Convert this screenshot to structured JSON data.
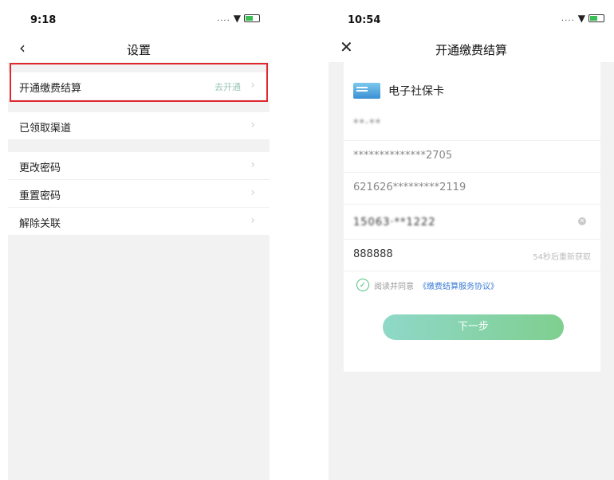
{
  "left": {
    "status_time": "9:18",
    "nav_title": "设置",
    "group1": [
      {
        "label": "开通缴费结算",
        "value": "去开通"
      }
    ],
    "group2": [
      {
        "label": "已领取渠道"
      }
    ],
    "group3": [
      {
        "label": "更改密码"
      },
      {
        "label": "重置密码"
      },
      {
        "label": "解除关联"
      }
    ]
  },
  "right": {
    "status_time": "10:54",
    "nav_title": "开通缴费结算",
    "card_title": "电子社保卡",
    "name_masked": "**·**",
    "id_number": "**************2705",
    "bank_card": "621626*********2119",
    "phone_masked": "15063·**1222",
    "sms_code": "888888",
    "sms_countdown": "54秒后重新获取",
    "agree_prefix": "阅读并同意",
    "agree_link": "《缴费结算服务协议》",
    "next_button": "下一步"
  },
  "icons": {
    "back": "chevron-left",
    "close": "close",
    "chevron": "chevron-right",
    "check": "check-circle",
    "clear": "clear-circle",
    "card": "social-security-card"
  },
  "colors": {
    "highlight": "#e0282e",
    "button_start": "#8fd8c9",
    "button_end": "#7fcf8f",
    "link": "#3a7bd5",
    "check": "#4fbf7d"
  }
}
